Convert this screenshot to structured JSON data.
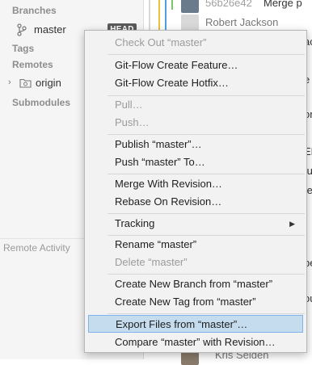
{
  "sidebar": {
    "branches_title": "Branches",
    "branch": {
      "label": "master",
      "badge": "HEAD"
    },
    "tags_title": "Tags",
    "remotes_title": "Remotes",
    "remote": {
      "label": "origin"
    },
    "submodules_title": "Submodules",
    "activity_title": "Remote Activity"
  },
  "commits": {
    "rows": [
      {
        "hash": "56b26e42",
        "text": "Merge p"
      },
      {
        "author": "Robert Jackson"
      },
      {
        "text": "ac"
      },
      {
        "text": "e p"
      },
      {
        "text": "on"
      },
      {
        "text": "EM"
      },
      {
        "text": "tu"
      },
      {
        "text": "te"
      },
      {
        "text": ""
      },
      {
        "text": "be"
      },
      {
        "text": "oul"
      },
      {
        "author": "Kris Selden"
      }
    ]
  },
  "menu": {
    "items": [
      {
        "label": "Check Out “master”",
        "disabled": true
      },
      {
        "label": "Git-Flow Create Feature…"
      },
      {
        "label": "Git-Flow Create Hotfix…"
      },
      {
        "label": "Pull…",
        "disabled": true
      },
      {
        "label": "Push…",
        "disabled": true
      },
      {
        "label": "Publish “master”…"
      },
      {
        "label": "Push “master” To…"
      },
      {
        "label": "Merge With Revision…"
      },
      {
        "label": "Rebase On Revision…"
      },
      {
        "label": "Tracking"
      },
      {
        "label": "Rename “master”"
      },
      {
        "label": "Delete “master”",
        "disabled": true
      },
      {
        "label": "Create New Branch from “master”"
      },
      {
        "label": "Create New Tag from “master”"
      },
      {
        "label": "Export Files from “master”…",
        "selected": true
      },
      {
        "label": "Compare “master” with Revision…"
      }
    ]
  },
  "colors": {
    "sidebar_bg": "#f5f5f5",
    "menu_bg": "#f2f2f2",
    "selection_bg": "#c5dcef",
    "selection_border": "#7eb4ea",
    "head_badge_bg": "#5a5a5a",
    "graph_blue": "#4aa3df",
    "graph_yellow": "#e8c23a",
    "graph_green": "#7cc46a"
  }
}
